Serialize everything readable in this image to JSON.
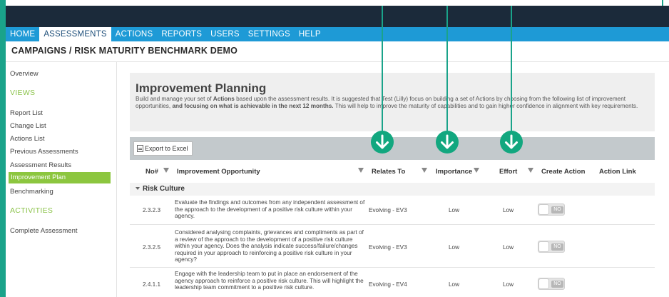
{
  "nav": {
    "items": [
      "HOME",
      "ASSESSMENTS",
      "ACTIONS",
      "REPORTS",
      "USERS",
      "SETTINGS",
      "HELP"
    ],
    "active": "ASSESSMENTS"
  },
  "breadcrumb": "CAMPAIGNS / RISK MATURITY BENCHMARK DEMO",
  "sidebar": {
    "overview": "Overview",
    "views_heading": "VIEWS",
    "views": [
      "Report List",
      "Change List",
      "Actions List",
      "Previous Assessments",
      "Assessment Results"
    ],
    "active": "Improvement Plan",
    "benchmarking": "Benchmarking",
    "activities_heading": "ACTIVITIES",
    "complete": "Complete Assessment"
  },
  "plan": {
    "title": "Improvement Planning",
    "desc_1": "Build and manage your set of ",
    "desc_bold_1": "Actions",
    "desc_2": " based upon the assessment results. It is suggested that Test (Lilly) focus on building a set of Actions by choosing from the following list of improvement opportunities, ",
    "desc_bold_2": "and focusing on what is achievable in the next 12 months.",
    "desc_3": " This will help to improve the maturity of capabilities and to gain higher confidence in alignment with key requirements."
  },
  "toolbar": {
    "export_label": "Export to Excel"
  },
  "table": {
    "headers": {
      "no": "No#",
      "opportunity": "Improvement Opportunity",
      "relates": "Relates To",
      "importance": "Importance",
      "effort": "Effort",
      "create": "Create Action",
      "link": "Action Link"
    },
    "group": "Risk Culture",
    "rows": [
      {
        "no": "2.3.2.3",
        "text": "Evaluate the findings and outcomes from any independent assessment of the approach to the development of a positive risk culture within your agency.",
        "relates": "Evolving - EV3",
        "importance": "Low",
        "effort": "Low",
        "toggle": "NO"
      },
      {
        "no": "2.3.2.5",
        "text": "Considered analysing complaints, grievances and compliments as part of a review of the approach to the development of a positive risk culture within your agency. Does the analysis indicate success/failure/changes required in your approach to reinforcing a positive risk culture in your agency?",
        "relates": "Evolving - EV3",
        "importance": "Low",
        "effort": "Low",
        "toggle": "NO"
      },
      {
        "no": "2.4.1.1",
        "text": "Engage with the leadership team to put in place an endorsement of the agency approach to reinforce a positive risk culture. This will highlight the leadership team commitment to a positive risk culture.",
        "relates": "Evolving - EV4",
        "importance": "Low",
        "effort": "Low",
        "toggle": "NO"
      }
    ]
  },
  "colors": {
    "nav_blue": "#1e9ad6",
    "sidebar_green": "#8cc63f",
    "callout_green": "#12a77f",
    "frame_teal": "#1aa38a"
  },
  "icons": [
    "excel-icon",
    "filter-icon",
    "down-arrow-icon",
    "collapse-triangle-icon"
  ]
}
